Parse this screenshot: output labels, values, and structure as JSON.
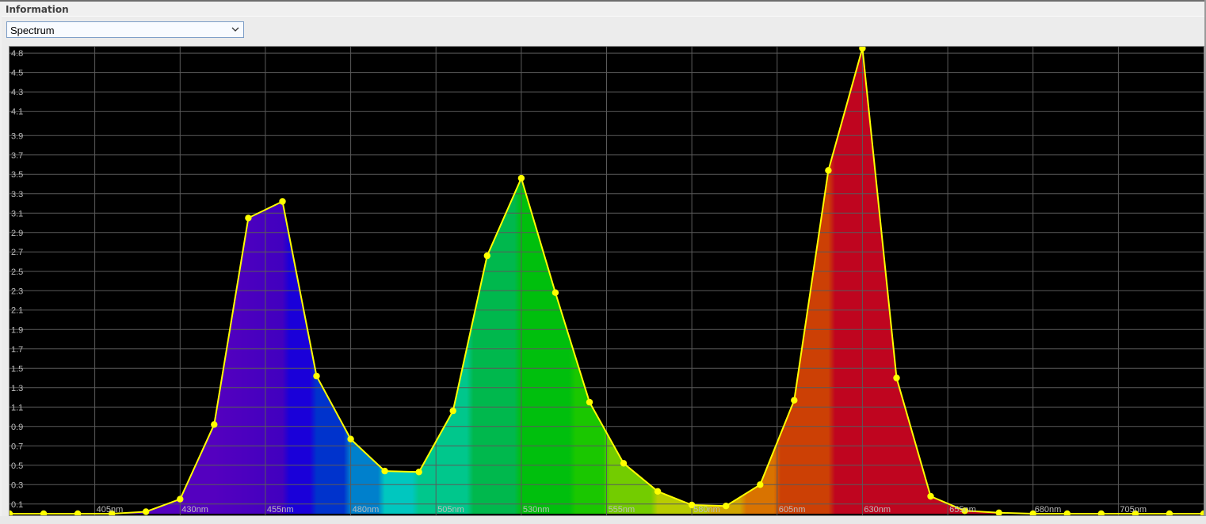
{
  "panel": {
    "title": "Information"
  },
  "view_selector": {
    "selected": "Spectrum",
    "icon": "chevron-down-icon"
  },
  "colors": {
    "background": "#000000",
    "grid_line": "#5a5a5a",
    "curve": "#ffff00",
    "tick_label": "#bcbcbc"
  },
  "chart_data": {
    "type": "area",
    "title": "",
    "xlabel": "",
    "ylabel": "",
    "x_unit": "nm",
    "xlim": [
      380,
      730
    ],
    "ylim": [
      0,
      4.8
    ],
    "grid": true,
    "legend": "none",
    "fill": "spectral wavelength color gradient under curve",
    "x_ticks": [
      "405nm",
      "430nm",
      "455nm",
      "480nm",
      "505nm",
      "530nm",
      "555nm",
      "580nm",
      "605nm",
      "630nm",
      "655nm",
      "680nm",
      "705nm"
    ],
    "x_tick_values": [
      405,
      430,
      455,
      480,
      505,
      530,
      555,
      580,
      605,
      630,
      655,
      680,
      705
    ],
    "y_ticks": [
      "4.8",
      "4.5",
      "4.3",
      "4.1",
      "3.9",
      "3.7",
      "3.5",
      "3.3",
      "3.1",
      "2.9",
      "2.7",
      "2.5",
      "2.3",
      "2.1",
      "1.9",
      "1.7",
      "1.5",
      "1.3",
      "1.1",
      "0.9",
      "0.7",
      "0.5",
      "0.3",
      "0.1"
    ],
    "y_tick_values": [
      4.75,
      4.55,
      4.35,
      4.15,
      3.9,
      3.7,
      3.5,
      3.3,
      3.1,
      2.9,
      2.7,
      2.5,
      2.3,
      2.1,
      1.9,
      1.7,
      1.5,
      1.3,
      1.1,
      0.9,
      0.7,
      0.5,
      0.3,
      0.1
    ],
    "series": [
      {
        "x": [
          380,
          390,
          400,
          410,
          420,
          430,
          440,
          450,
          460,
          470,
          480,
          490,
          500,
          510,
          520,
          530,
          540,
          550,
          560,
          570,
          580,
          590,
          600,
          610,
          620,
          630,
          640,
          650,
          660,
          670,
          680,
          690,
          700,
          710,
          720,
          730
        ],
        "y": [
          0.0,
          0.0,
          0.0,
          0.0,
          0.02,
          0.15,
          0.92,
          3.05,
          3.22,
          1.42,
          0.77,
          0.44,
          0.43,
          1.06,
          2.66,
          3.46,
          2.28,
          1.15,
          0.52,
          0.23,
          0.09,
          0.08,
          0.3,
          1.17,
          3.54,
          4.8,
          1.4,
          0.18,
          0.03,
          0.01,
          0.0,
          0.0,
          0.0,
          0.0,
          0.0,
          0.0
        ]
      }
    ]
  }
}
